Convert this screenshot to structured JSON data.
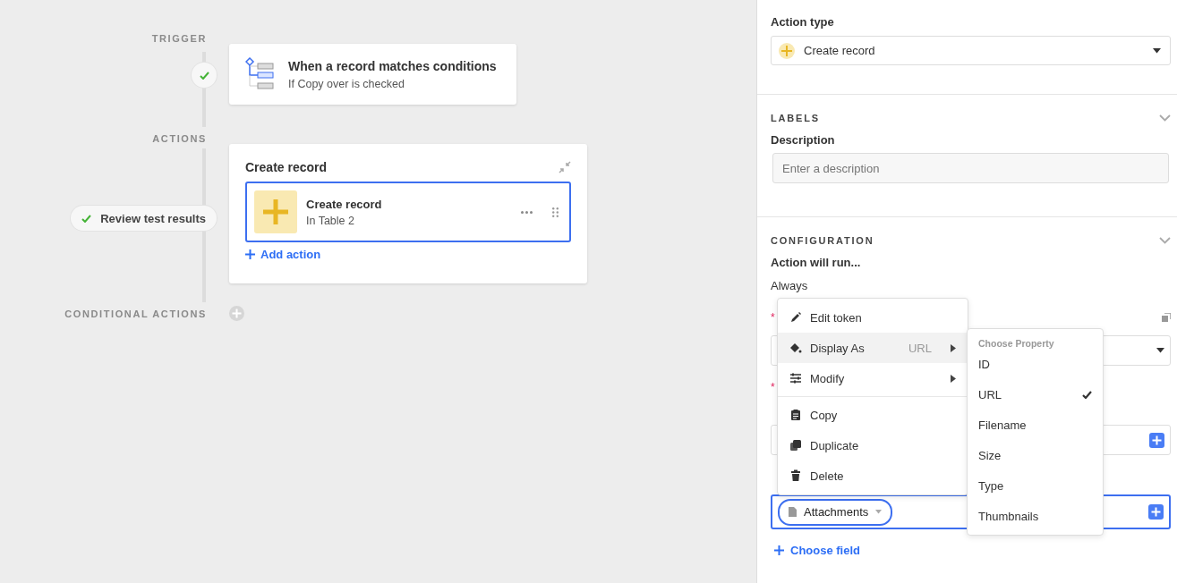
{
  "flow": {
    "trigger": {
      "section_label": "TRIGGER",
      "done": true,
      "title": "When a record matches conditions",
      "subtitle": "If Copy over is checked"
    },
    "actions": {
      "section_label": "ACTIONS",
      "test_button": "Review test results",
      "test_done": true,
      "card_title": "Create record",
      "items": [
        {
          "title": "Create record",
          "subtitle": "In Table 2",
          "selected": true
        }
      ],
      "add_action": "Add action"
    },
    "conditional": {
      "section_label": "CONDITIONAL ACTIONS"
    }
  },
  "panel": {
    "action_type_label": "Action type",
    "action_type_value": "Create record",
    "labels": {
      "title": "LABELS",
      "description_label": "Description",
      "description_placeholder": "Enter a description"
    },
    "configuration": {
      "title": "CONFIGURATION",
      "run_label": "Action will run...",
      "run_value": "Always",
      "fields": [
        {
          "kind": "select",
          "required_mark": "*",
          "focused": false
        },
        {
          "kind": "token",
          "required_mark": "*",
          "focused": false
        },
        {
          "kind": "token",
          "focused": true,
          "token": "Attachments"
        }
      ],
      "choose_field": "Choose field"
    }
  },
  "context_menu": {
    "groups": [
      [
        {
          "label": "Edit token",
          "submenu": false,
          "selected": false
        },
        {
          "label": "Display As",
          "value": "URL",
          "submenu": true,
          "selected": true
        },
        {
          "label": "Modify",
          "submenu": true,
          "selected": false
        }
      ],
      [
        {
          "label": "Copy",
          "submenu": false,
          "selected": false
        },
        {
          "label": "Duplicate",
          "submenu": false,
          "selected": false
        },
        {
          "label": "Delete",
          "submenu": false,
          "selected": false
        }
      ]
    ]
  },
  "submenu": {
    "heading": "Choose Property",
    "options": [
      {
        "label": "ID",
        "checked": false
      },
      {
        "label": "URL",
        "checked": true
      },
      {
        "label": "Filename",
        "checked": false
      },
      {
        "label": "Size",
        "checked": false
      },
      {
        "label": "Type",
        "checked": false
      },
      {
        "label": "Thumbnails",
        "checked": false
      }
    ]
  }
}
